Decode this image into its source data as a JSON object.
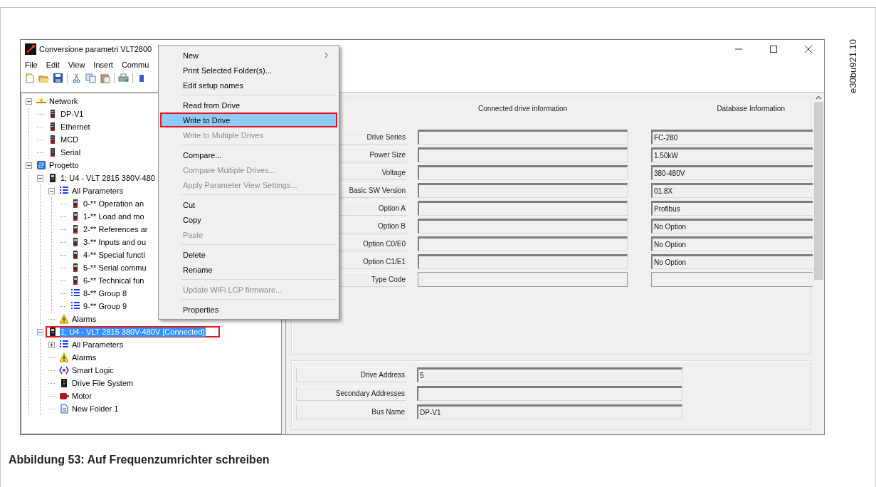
{
  "window": {
    "title": "Conversione parametri VLT2800"
  },
  "menu_bar": [
    "File",
    "Edit",
    "View",
    "Insert",
    "Commu"
  ],
  "tree": [
    {
      "label": "Network",
      "kind": "network",
      "expanded": true,
      "selected": false,
      "annotated": false,
      "children": [
        {
          "label": "DP-V1",
          "kind": "bus",
          "selected": false,
          "annotated": false
        },
        {
          "label": "Ethernet",
          "kind": "bus",
          "selected": false,
          "annotated": false
        },
        {
          "label": "MCD",
          "kind": "bus",
          "selected": false,
          "annotated": false
        },
        {
          "label": "Serial",
          "kind": "bus",
          "selected": false,
          "annotated": false
        }
      ]
    },
    {
      "label": "Progetto",
      "kind": "project",
      "expanded": true,
      "selected": false,
      "annotated": false,
      "children": [
        {
          "label": "1; U4 - VLT 2815 380V-480",
          "kind": "drive",
          "expanded": true,
          "selected": false,
          "annotated": false,
          "children": [
            {
              "label": "All Parameters",
              "kind": "list",
              "expanded": true,
              "selected": false,
              "annotated": false,
              "children": [
                {
                  "label": "0-** Operation an",
                  "kind": "parameter",
                  "selected": false,
                  "annotated": false
                },
                {
                  "label": "1-** Load and mo",
                  "kind": "parameter",
                  "selected": false,
                  "annotated": false
                },
                {
                  "label": "2-** References ar",
                  "kind": "parameter",
                  "selected": false,
                  "annotated": false
                },
                {
                  "label": "3-** Inputs and ou",
                  "kind": "parameter",
                  "selected": false,
                  "annotated": false
                },
                {
                  "label": "4-** Special functi",
                  "kind": "parameter",
                  "selected": false,
                  "annotated": false
                },
                {
                  "label": "5-** Serial commu",
                  "kind": "parameter",
                  "selected": false,
                  "annotated": false
                },
                {
                  "label": "6-** Technical fun",
                  "kind": "parameter",
                  "selected": false,
                  "annotated": false
                },
                {
                  "label": "8-** Group 8",
                  "kind": "list",
                  "selected": false,
                  "annotated": false
                },
                {
                  "label": "9-** Group 9",
                  "kind": "list",
                  "selected": false,
                  "annotated": false
                }
              ]
            },
            {
              "label": "Alarms",
              "kind": "alarm",
              "selected": false,
              "annotated": false
            }
          ]
        },
        {
          "label": "1; U4 - VLT 2815 380V-480V [Connected]",
          "kind": "drive",
          "expanded": true,
          "selected": true,
          "annotated": true,
          "children": [
            {
              "label": "All Parameters",
              "kind": "list",
              "expanded": false,
              "selected": false,
              "annotated": false
            },
            {
              "label": "Alarms",
              "kind": "alarm",
              "selected": false,
              "annotated": false
            },
            {
              "label": "Smart Logic",
              "kind": "logic",
              "selected": false,
              "annotated": false
            },
            {
              "label": "Drive File System",
              "kind": "device",
              "selected": false,
              "annotated": false
            },
            {
              "label": "Motor",
              "kind": "motor",
              "selected": false,
              "annotated": false
            },
            {
              "label": "New Folder 1",
              "kind": "document",
              "selected": false,
              "annotated": false
            }
          ]
        }
      ]
    }
  ],
  "context_menu": [
    {
      "kind": "item",
      "label": "New",
      "submenu": true,
      "disabled": false,
      "selected": false,
      "annotated": false
    },
    {
      "kind": "item",
      "label": "Print Selected Folder(s)...",
      "submenu": false,
      "disabled": false,
      "selected": false,
      "annotated": false
    },
    {
      "kind": "item",
      "label": "Edit setup names",
      "submenu": false,
      "disabled": false,
      "selected": false,
      "annotated": false
    },
    {
      "kind": "separator"
    },
    {
      "kind": "item",
      "label": "Read from Drive",
      "submenu": false,
      "disabled": false,
      "selected": false,
      "annotated": false
    },
    {
      "kind": "item",
      "label": "Write to Drive",
      "submenu": false,
      "disabled": false,
      "selected": true,
      "annotated": true
    },
    {
      "kind": "item",
      "label": "Write to Multiple Drives",
      "submenu": false,
      "disabled": true,
      "selected": false,
      "annotated": false
    },
    {
      "kind": "separator"
    },
    {
      "kind": "item",
      "label": "Compare...",
      "submenu": false,
      "disabled": false,
      "selected": false,
      "annotated": false
    },
    {
      "kind": "item",
      "label": "Compare Multiple Drives...",
      "submenu": false,
      "disabled": true,
      "selected": false,
      "annotated": false
    },
    {
      "kind": "item",
      "label": "Apply Parameter View Settings...",
      "submenu": false,
      "disabled": true,
      "selected": false,
      "annotated": false
    },
    {
      "kind": "separator"
    },
    {
      "kind": "item",
      "label": "Cut",
      "submenu": false,
      "disabled": false,
      "selected": false,
      "annotated": false
    },
    {
      "kind": "item",
      "label": "Copy",
      "submenu": false,
      "disabled": false,
      "selected": false,
      "annotated": false
    },
    {
      "kind": "item",
      "label": "Paste",
      "submenu": false,
      "disabled": true,
      "selected": false,
      "annotated": false
    },
    {
      "kind": "separator"
    },
    {
      "kind": "item",
      "label": "Delete",
      "submenu": false,
      "disabled": false,
      "selected": false,
      "annotated": false
    },
    {
      "kind": "item",
      "label": "Rename",
      "submenu": false,
      "disabled": false,
      "selected": false,
      "annotated": false
    },
    {
      "kind": "separator"
    },
    {
      "kind": "item",
      "label": "Update WiFi LCP firmware...",
      "submenu": false,
      "disabled": true,
      "selected": false,
      "annotated": false
    },
    {
      "kind": "separator"
    },
    {
      "kind": "item",
      "label": "Properties",
      "submenu": false,
      "disabled": false,
      "selected": false,
      "annotated": false
    }
  ],
  "drive_info": {
    "connected_header": "Connected drive information",
    "database_header": "Database Information",
    "rows": [
      {
        "label": "Drive Series",
        "database": "FC-280"
      },
      {
        "label": "Power Size",
        "database": "1.50kW"
      },
      {
        "label": "Voltage",
        "database": "380-480V"
      },
      {
        "label": "Basic SW Version",
        "database": "01.8X"
      },
      {
        "label": "Option A",
        "database": "Profibus"
      },
      {
        "label": "Option B",
        "database": "No Option"
      },
      {
        "label": "Option C0/E0",
        "database": "No Option"
      },
      {
        "label": "Option C1/E1",
        "database": "No Option"
      },
      {
        "label": "Type Code"
      }
    ]
  },
  "bus_info": {
    "rows": [
      {
        "label": "Drive Address",
        "value": "5"
      },
      {
        "label": "Secondary Addresses"
      },
      {
        "label": "Bus Name",
        "value": "DP-V1"
      }
    ]
  },
  "figure_code": "e30bu921.10",
  "caption": "Abbildung 53: Auf Frequenzumrichter schreiben"
}
